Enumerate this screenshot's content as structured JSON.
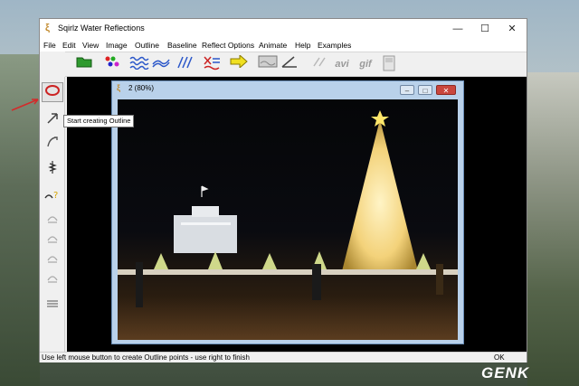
{
  "window": {
    "title": "Sqirlz Water Reflections",
    "controls": [
      "—",
      "☐",
      "✕"
    ]
  },
  "menu": [
    "File",
    "Edit",
    "View",
    "Image",
    "Outline",
    "Baseline",
    "Reflect Options",
    "Animate",
    "Help",
    "Examples"
  ],
  "toolbar": {
    "avi_label": "avi",
    "gif_label": "gif"
  },
  "tooltip": "Start creating Outline",
  "child_window": {
    "title": "2  (80%)"
  },
  "status": {
    "message": "Use left mouse button to create Outline points - use right to finish",
    "ok": "OK"
  },
  "watermark": "GENK"
}
